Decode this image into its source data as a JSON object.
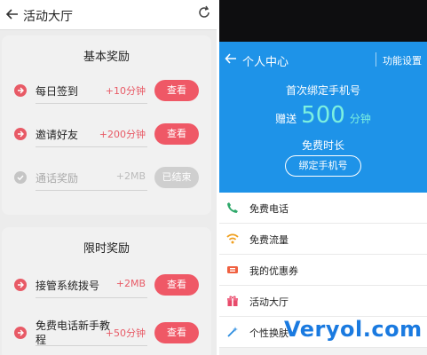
{
  "left": {
    "topbar": {
      "title": "活动大厅"
    },
    "basic": {
      "title": "基本奖励",
      "rows": [
        {
          "label": "每日签到",
          "reward": "+10分钟",
          "button": "查看"
        },
        {
          "label": "邀请好友",
          "reward": "+200分钟",
          "button": "查看"
        },
        {
          "label": "通话奖励",
          "reward": "+2MB",
          "button": "已结束"
        }
      ]
    },
    "limited": {
      "title": "限时奖励",
      "rows": [
        {
          "label": "接管系统拨号",
          "reward": "+2MB",
          "button": "查看"
        },
        {
          "label": "免费电话新手教程",
          "reward": "+50分钟",
          "button": "查看"
        }
      ]
    },
    "accent_color": "#ef5866"
  },
  "right": {
    "header": {
      "title": "个人中心",
      "settings": "功能设置",
      "line1": "首次绑定手机号",
      "bonus_prefix": "赠送",
      "bonus_number": "500",
      "bonus_unit": "分钟",
      "line3": "免费时长",
      "button": "绑定手机号",
      "bg_color": "#1e93e8"
    },
    "menu": [
      {
        "label": "免费电话",
        "icon": "phone-icon"
      },
      {
        "label": "免费流量",
        "icon": "wifi-icon"
      },
      {
        "label": "我的优惠券",
        "icon": "ticket-icon"
      },
      {
        "label": "活动大厅",
        "icon": "gift-icon"
      },
      {
        "label": "个性换肤",
        "icon": "wand-icon"
      }
    ]
  },
  "watermark": "Veryol.com"
}
